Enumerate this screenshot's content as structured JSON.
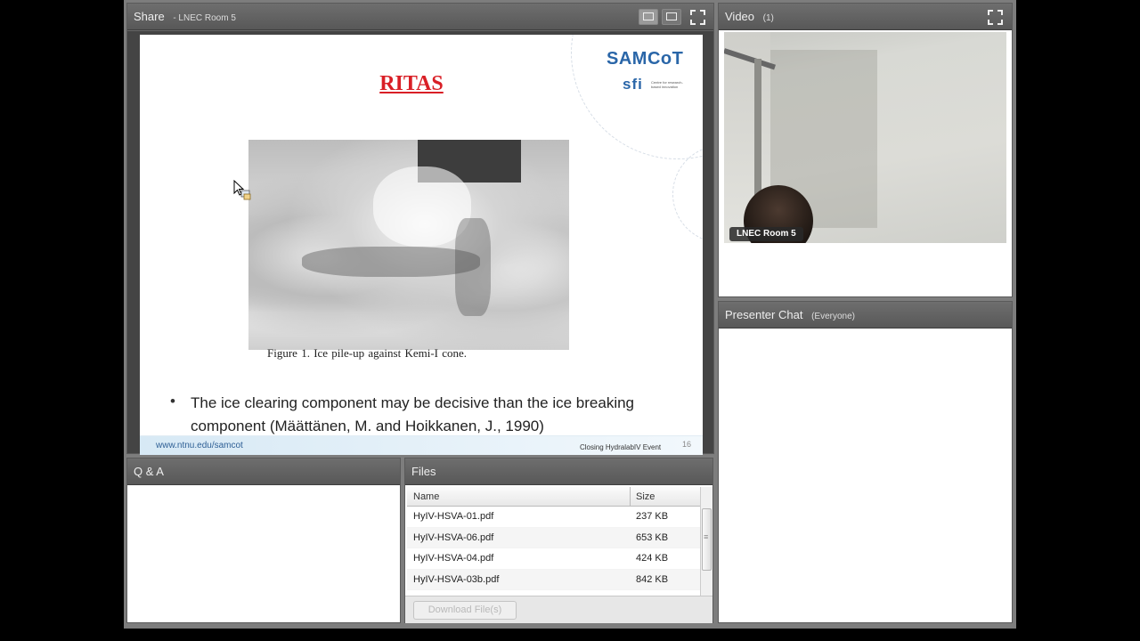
{
  "share_pod": {
    "title": "Share",
    "subtitle": "- LNEC Room 5",
    "slide": {
      "title": "RITAS",
      "logo": "SAMCoT",
      "logo_sub": "sfi",
      "logo_small": "Centre for research-based innovation",
      "figure_caption": "Figure 1. Ice pile-up against Kemi-I cone.",
      "bullet_mark": "•",
      "bullet_text": "The ice clearing component may be decisive than the ice breaking component (Määttänen, M. and Hoikkanen, J., 1990)",
      "footer_url": "www.ntnu.edu/samcot",
      "footer_event": "Closing HydralabIV Event",
      "page_number": "16"
    }
  },
  "video_pod": {
    "title": "Video",
    "count": "(1)",
    "feed_label": "LNEC Room 5"
  },
  "chat_pod": {
    "title": "Presenter Chat",
    "audience": "(Everyone)"
  },
  "qa_pod": {
    "title": "Q & A"
  },
  "files_pod": {
    "title": "Files",
    "columns": {
      "name": "Name",
      "size": "Size"
    },
    "files": [
      {
        "name": "HyIV-HSVA-01.pdf",
        "size": "237 KB"
      },
      {
        "name": "HyIV-HSVA-06.pdf",
        "size": "653 KB"
      },
      {
        "name": "HyIV-HSVA-04.pdf",
        "size": "424 KB"
      },
      {
        "name": "HyIV-HSVA-03b.pdf",
        "size": "842 KB"
      }
    ],
    "download_label": "Download File(s)"
  },
  "icons": {
    "share_toggle": "screen-icon",
    "maximize": "maximize-icon",
    "cursor": "cursor-icon"
  }
}
